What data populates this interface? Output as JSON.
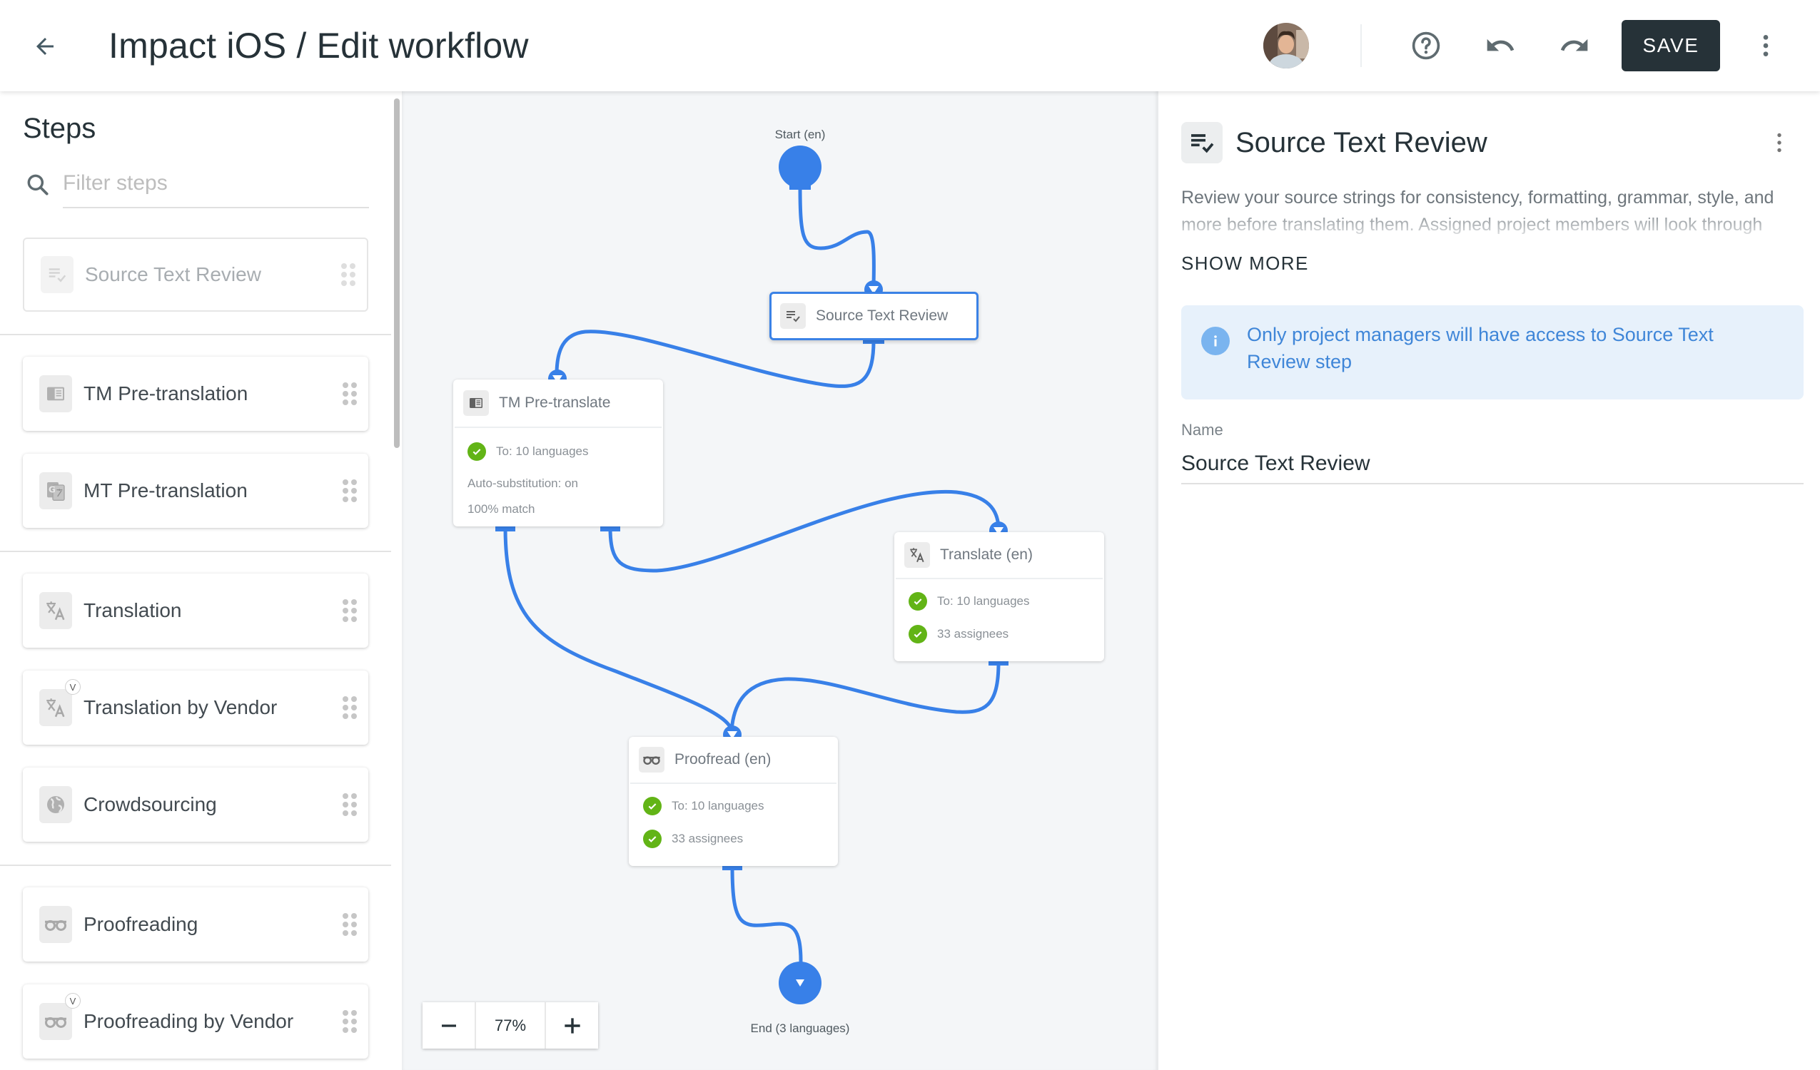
{
  "header": {
    "title": "Impact iOS / Edit workflow",
    "back_icon": "arrow-left-icon",
    "avatar_alt": "User avatar",
    "help_icon": "help-circle-icon",
    "undo_icon": "undo-icon",
    "redo_icon": "redo-icon",
    "save_label": "SAVE",
    "more_icon": "more-vertical-icon"
  },
  "sidebar": {
    "title": "Steps",
    "filter": {
      "placeholder": "Filter steps",
      "value": ""
    },
    "groups": [
      {
        "items": [
          {
            "label": "Source Text Review",
            "icon": "source-review-icon",
            "disabled": true,
            "vendor": false
          }
        ]
      },
      {
        "items": [
          {
            "label": "TM Pre-translation",
            "icon": "tm-icon",
            "disabled": false,
            "vendor": false
          },
          {
            "label": "MT Pre-translation",
            "icon": "machine-translate-icon",
            "disabled": false,
            "vendor": false
          }
        ]
      },
      {
        "items": [
          {
            "label": "Translation",
            "icon": "translate-icon",
            "disabled": false,
            "vendor": false
          },
          {
            "label": "Translation by Vendor",
            "icon": "translate-icon",
            "disabled": false,
            "vendor": true,
            "badge": "V"
          },
          {
            "label": "Crowdsourcing",
            "icon": "globe-icon",
            "disabled": false,
            "vendor": false
          }
        ]
      },
      {
        "items": [
          {
            "label": "Proofreading",
            "icon": "glasses-icon",
            "disabled": false,
            "vendor": false
          },
          {
            "label": "Proofreading by Vendor",
            "icon": "glasses-icon",
            "disabled": false,
            "vendor": true,
            "badge": "V"
          }
        ]
      }
    ]
  },
  "canvas": {
    "start": {
      "label": "Start (en)"
    },
    "end": {
      "label": "End (3 languages)"
    },
    "nodes": {
      "source_review": {
        "title": "Source Text Review",
        "selected": true
      },
      "tm_pretranslate": {
        "title": "TM Pre-translate",
        "rows": [
          "To: 10 languages"
        ],
        "notes": [
          "Auto-substitution: on",
          "100% match"
        ]
      },
      "translate": {
        "title": "Translate (en)",
        "rows": [
          "To: 10 languages",
          "33 assignees"
        ]
      },
      "proofread": {
        "title": "Proofread (en)",
        "rows": [
          "To: 10 languages",
          "33 assignees"
        ]
      }
    },
    "edges": [
      {
        "from": "start",
        "to": "source_review"
      },
      {
        "from": "source_review",
        "to": "tm_pretranslate"
      },
      {
        "from": "tm_pretranslate",
        "to": "proofread"
      },
      {
        "from": "tm_pretranslate",
        "to": "translate"
      },
      {
        "from": "translate",
        "to": "proofread"
      },
      {
        "from": "proofread",
        "to": "end"
      }
    ],
    "zoom": {
      "value": "77%",
      "minus_icon": "minus-icon",
      "plus_icon": "plus-icon"
    },
    "colors": {
      "edge": "#3880e8",
      "check": "#62b416"
    }
  },
  "panel": {
    "title": "Source Text Review",
    "description": "Review your source strings for consistency, formatting, grammar, style, and more before translating them. Assigned project members will look through",
    "show_more": "SHOW MORE",
    "info": "Only project managers will have access to Source Text Review step",
    "name_label": "Name",
    "name_value": "Source Text Review"
  }
}
